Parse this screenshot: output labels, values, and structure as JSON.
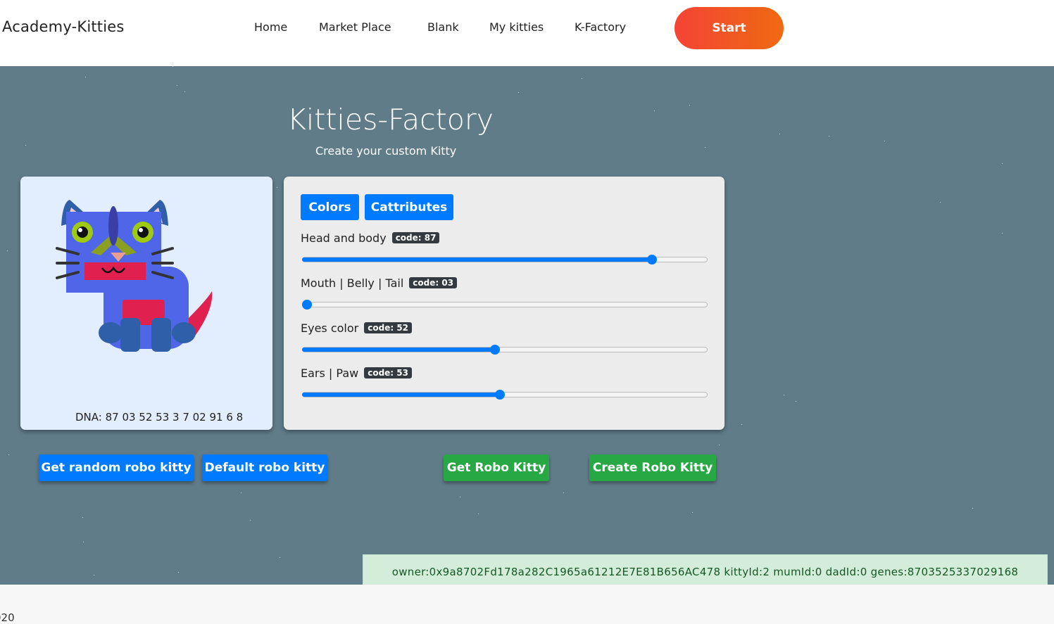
{
  "navbar": {
    "brand": "Academy-Kitties",
    "links": [
      "Home",
      "Market Place",
      "Blank",
      "My kitties",
      "K-Factory"
    ],
    "start_label": "Start"
  },
  "factory": {
    "title": "Kitties-Factory",
    "subtitle": "Create your custom Kitty",
    "dna_text": "DNA: 87 03 52 53 3 7 02 91 6 8"
  },
  "tabs": [
    "Colors",
    "Cattributes"
  ],
  "controls": [
    {
      "label": "Head and body",
      "badge": "code: 87",
      "value": 87,
      "min": 10,
      "max": 98
    },
    {
      "label": "Mouth | Belly | Tail",
      "badge": "code: 03",
      "value": 3,
      "min": 3,
      "max": 98
    },
    {
      "label": "Eyes color",
      "badge": "code: 52",
      "value": 52,
      "min": 10,
      "max": 98
    },
    {
      "label": "Ears | Paw",
      "badge": "code: 53",
      "value": 53,
      "min": 10,
      "max": 98
    }
  ],
  "buttons": {
    "random": "Get random robo kitty",
    "default": "Default robo kitty",
    "get": "Get Robo Kitty",
    "create": "Create Robo Kitty"
  },
  "alert_text": "owner:0x9a8702Fd178a282C1965a61212E7E81B656AC478 kittyId:2 mumId:0 dadId:0 genes:8703525337029168",
  "footer_text": "020",
  "colors": {
    "accent_blue": "#007bff",
    "accent_green": "#28a745",
    "background": "#607c89",
    "start_gradient": [
      "#f44336",
      "#ef6a12"
    ],
    "kitty_body": "#4f66e8",
    "kitty_mouth": "#e0204e",
    "kitty_eyes": "#9ecb10",
    "kitty_ears": "#2f5fa8"
  },
  "kitty_image_alt": "robo-kitty"
}
